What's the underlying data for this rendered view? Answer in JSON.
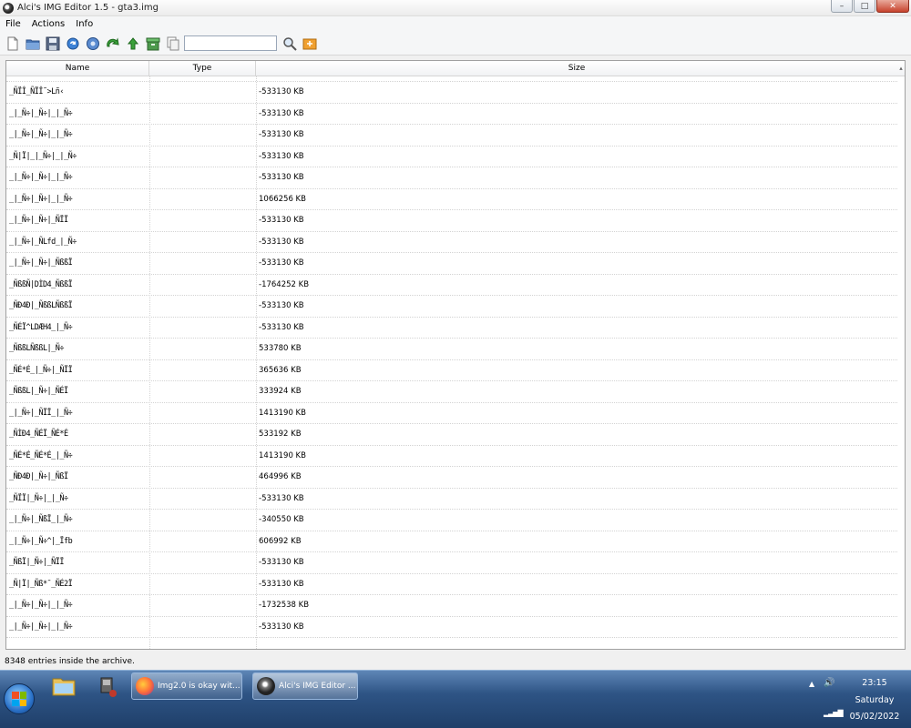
{
  "window": {
    "title": "Alci's IMG Editor 1.5 - gta3.img",
    "minimize": "–",
    "maximize": "□",
    "close": "✕"
  },
  "menu": [
    "File",
    "Actions",
    "Info"
  ],
  "toolbar": {
    "icons": [
      "new-file-icon",
      "open-folder-icon",
      "save-icon",
      "refresh-icon",
      "settings-gear-icon",
      "redo-arrow-icon",
      "import-arrow-icon",
      "archive-box-icon",
      "copy-pages-icon",
      "search-icon",
      "export-icon"
    ],
    "search_value": ""
  },
  "table": {
    "columns": [
      "Name",
      "Type",
      "Size"
    ],
    "rows": [
      {
        "name": "_ÑÏÎ_ÑÏÎ˜>Lñ‹",
        "type": "",
        "size": "-533130 KB"
      },
      {
        "name": "_|_Ñ÷|_Ñ÷|_|_Ñ÷",
        "type": "",
        "size": "-533130 KB"
      },
      {
        "name": "_|_Ñ÷|_Ñ÷|_|_Ñ÷",
        "type": "",
        "size": "-533130 KB"
      },
      {
        "name": "_Ñ|Ï|_|_Ñ÷|_|_Ñ÷",
        "type": "",
        "size": "-533130 KB"
      },
      {
        "name": "_|_Ñ÷|_Ñ÷|_|_Ñ÷",
        "type": "",
        "size": "-533130 KB"
      },
      {
        "name": "_|_Ñ÷|_Ñ÷|_|_Ñ÷",
        "type": "",
        "size": "1066256 KB"
      },
      {
        "name": "_|_Ñ÷|_Ñ÷|_ÑÏÏ",
        "type": "",
        "size": "-533130 KB"
      },
      {
        "name": "_|_Ñ÷|_ÑLfd_|_Ñ÷",
        "type": "",
        "size": "-533130 KB"
      },
      {
        "name": "_|_Ñ÷|_Ñ÷|_ÑßßÏ",
        "type": "",
        "size": "-533130 KB"
      },
      {
        "name": "_ÑßßÑ|DÌD4_ÑßßÏ",
        "type": "",
        "size": "-1764252 KB"
      },
      {
        "name": "_ÑÐ4Ð|_ÑßßLÑßßÏ",
        "type": "",
        "size": "-533130 KB"
      },
      {
        "name": "_ÑÉÏ^LDÆH4_|_Ñ÷",
        "type": "",
        "size": "-533130 KB"
      },
      {
        "name": "_ÑßßLÑßßL|_Ñ÷",
        "type": "",
        "size": "533780 KB"
      },
      {
        "name": "_ÑÉ*É_|_Ñ÷|_ÑÏÏ",
        "type": "",
        "size": "365636 KB"
      },
      {
        "name": "_ÑßßL|_Ñ÷|_ÑÉÏ",
        "type": "",
        "size": "333924 KB"
      },
      {
        "name": "_|_Ñ÷|_ÑÏÏ_|_Ñ÷",
        "type": "",
        "size": "1413190 KB"
      },
      {
        "name": "_ÑÌÐ4_ÑÉÏ_ÑÉ*É",
        "type": "",
        "size": "533192 KB"
      },
      {
        "name": "_ÑÉ*É_ÑÉ*É_|_Ñ÷",
        "type": "",
        "size": "1413190 KB"
      },
      {
        "name": "_ÑÐ4Ð|_Ñ÷|_ÑßÏ",
        "type": "",
        "size": "464996 KB"
      },
      {
        "name": "_ÑÏÏ|_Ñ÷|_|_Ñ÷",
        "type": "",
        "size": "-533130 KB"
      },
      {
        "name": "_|_Ñ÷|_ÑßÏ_|_Ñ÷",
        "type": "",
        "size": "-340550 KB"
      },
      {
        "name": "_|_Ñ÷|_Ñ÷^|_Ïfb",
        "type": "",
        "size": "606992 KB"
      },
      {
        "name": "_ÑßÏ|_Ñ÷|_ÑÏÏ",
        "type": "",
        "size": "-533130 KB"
      },
      {
        "name": "_Ñ|Ï|_Ñß*¯_ÑÉ2Ï",
        "type": "",
        "size": "-533130 KB"
      },
      {
        "name": "_|_Ñ÷|_Ñ÷|_|_Ñ÷",
        "type": "",
        "size": "-1732538 KB"
      },
      {
        "name": "_|_Ñ÷|_Ñ÷|_|_Ñ÷",
        "type": "",
        "size": "-533130 KB"
      }
    ]
  },
  "status": "8348 entries inside the archive.",
  "taskbar": {
    "pinned": [
      "explorer-folder-icon",
      "app-shortcut-icon"
    ],
    "tasks": [
      {
        "label": "Img2.0 is okay wit...",
        "icon": "firefox-icon"
      },
      {
        "label": "Alci's IMG Editor ...",
        "icon": "img-editor-icon"
      }
    ],
    "tray": {
      "arrow": "▲",
      "volume": "🔊",
      "network": "▂▃▅▇",
      "time": "23:15",
      "day": "Saturday",
      "date": "05/02/2022"
    }
  }
}
